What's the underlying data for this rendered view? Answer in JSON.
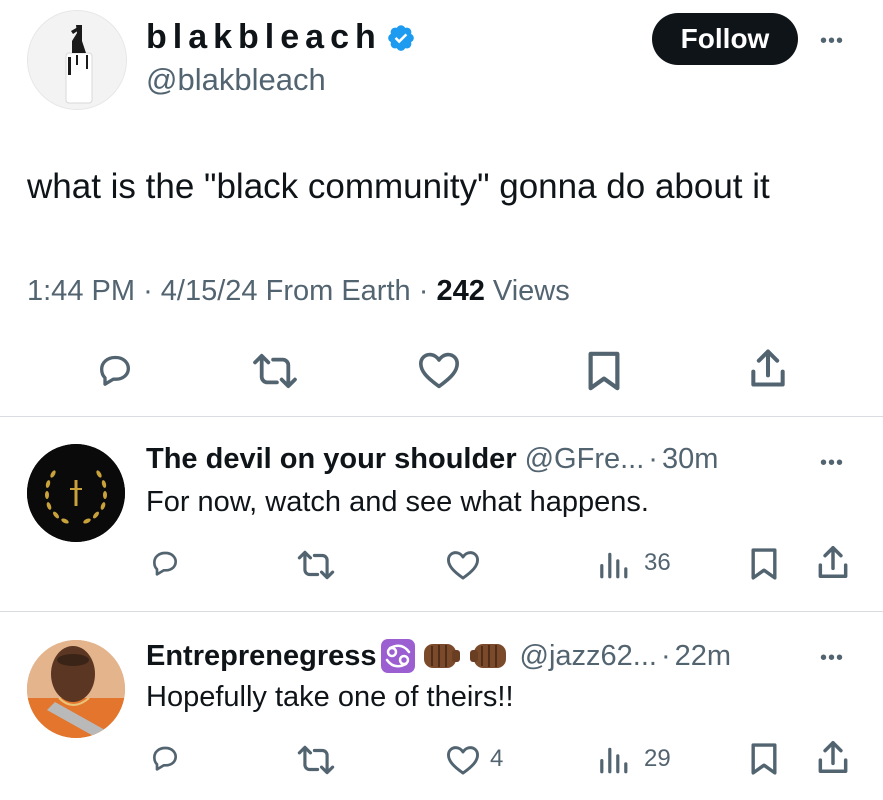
{
  "tweet": {
    "display_name": "blakbleach",
    "handle": "@blakbleach",
    "follow_label": "Follow",
    "more_label": "•••",
    "text": "what is the \"black community\" gonna do about it",
    "time": "1:44 PM",
    "date": "4/15/24",
    "source": "From Earth",
    "sep": "·",
    "views_count": "242",
    "views_label": "Views"
  },
  "replies": [
    {
      "name": "The devil on your shoulder",
      "handle": "@GFre...",
      "time": "30m",
      "text": "For now, watch and see what happens.",
      "views": "36"
    },
    {
      "name": "Entreprenegress",
      "handle": "@jazz62...",
      "time": "22m",
      "text": "Hopefully take one of theirs!!",
      "likes": "4",
      "views": "29"
    }
  ],
  "colors": {
    "text": "#0f1419",
    "secondary": "#536471",
    "verified": "#1d9bf0",
    "divider": "#d9dde1"
  }
}
